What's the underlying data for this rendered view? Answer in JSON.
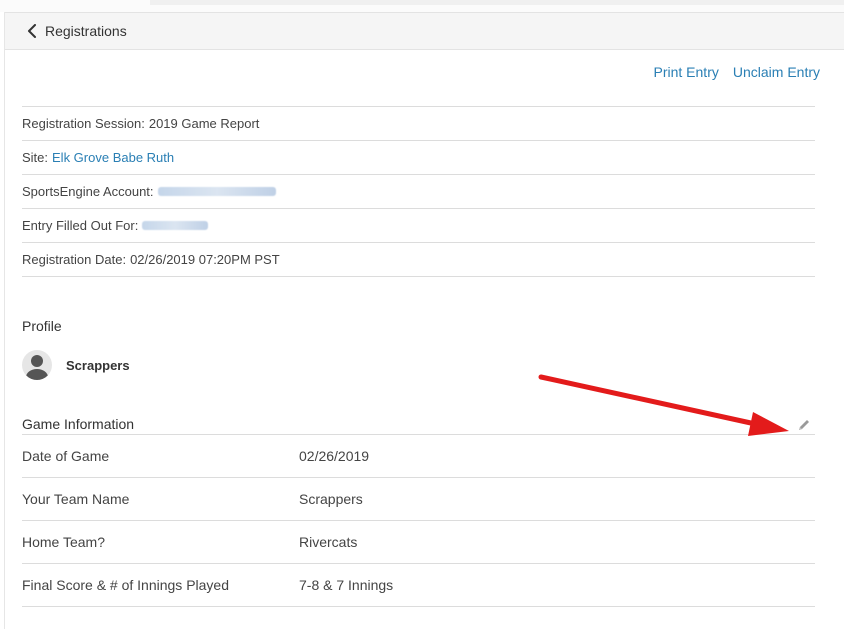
{
  "header": {
    "back_label": "Registrations"
  },
  "actions": {
    "print_label": "Print Entry",
    "unclaim_label": "Unclaim Entry"
  },
  "info": {
    "session_label": "Registration Session:",
    "session_value": "2019 Game Report",
    "site_label": "Site:",
    "site_value": "Elk Grove Babe Ruth",
    "account_label": "SportsEngine Account:",
    "entry_for_label": "Entry Filled Out For:",
    "date_label": "Registration Date:",
    "date_value": "02/26/2019 07:20PM PST"
  },
  "profile": {
    "title": "Profile",
    "name": "Scrappers"
  },
  "game": {
    "title": "Game Information",
    "rows": [
      {
        "label": "Date of Game",
        "value": "02/26/2019"
      },
      {
        "label": "Your Team Name",
        "value": "Scrappers"
      },
      {
        "label": "Home Team?",
        "value": "Rivercats"
      },
      {
        "label": "Final Score & # of Innings Played",
        "value": "7-8 & 7 Innings"
      }
    ]
  },
  "colors": {
    "link": "#2a7fb4",
    "annotation_arrow": "#e31b1b",
    "divider": "#dcdcdc"
  }
}
